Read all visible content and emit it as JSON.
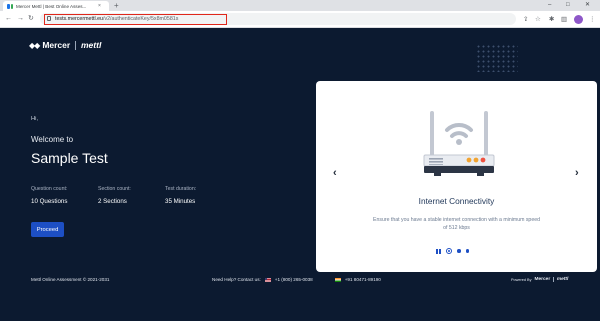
{
  "browser": {
    "tab_title": "Mercer Mettl | Best Online Asses...",
    "tab_close": "×",
    "new_tab": "+",
    "url_main": "tests.mercermettl.eu",
    "url_path": "/v2/authenticateKey/5x8m0581s",
    "window_controls": {
      "minimize": "–",
      "maximize": "□",
      "close": "✕"
    },
    "nav": {
      "back": "←",
      "forward": "→",
      "reload": "↻"
    },
    "toolbar_icons": {
      "share": "⇪",
      "star": "☆",
      "extensions": "✱",
      "sidepanel": "▥",
      "menu": "⋮"
    }
  },
  "page": {
    "logo": {
      "mark": "◆◆",
      "brand1": "Mercer",
      "brand2": "mettl"
    },
    "greeting": "Hi,",
    "welcome": "Welcome to",
    "test_name": "Sample Test",
    "stats": [
      {
        "label": "Question count:",
        "value": "10 Questions"
      },
      {
        "label": "Section count:",
        "value": "2 Sections"
      },
      {
        "label": "Test duration:",
        "value": "35 Minutes"
      }
    ],
    "proceed_label": "Proceed"
  },
  "card": {
    "prev": "‹",
    "next": "›",
    "title": "Internet Connectivity",
    "description": "Ensure that you have a stable internet connection with a minimum speed of 512 kbps",
    "slide_count": 3,
    "active_slide": 1
  },
  "footer": {
    "copyright": "Mettl Online Assessment © 2021-2031",
    "need_help": "Need Help? Contact us:",
    "phone_us": "+1 (800) 265-0038",
    "phone_in": "+91 80471-89190",
    "powered_by": "Powered By",
    "powered_brand1": "Mercer",
    "powered_brand2": "mettl"
  },
  "colors": {
    "page_bg": "#0c1a30",
    "accent": "#1d4fc4",
    "url_highlight": "#e0271b",
    "profile": "#8e57c8"
  }
}
